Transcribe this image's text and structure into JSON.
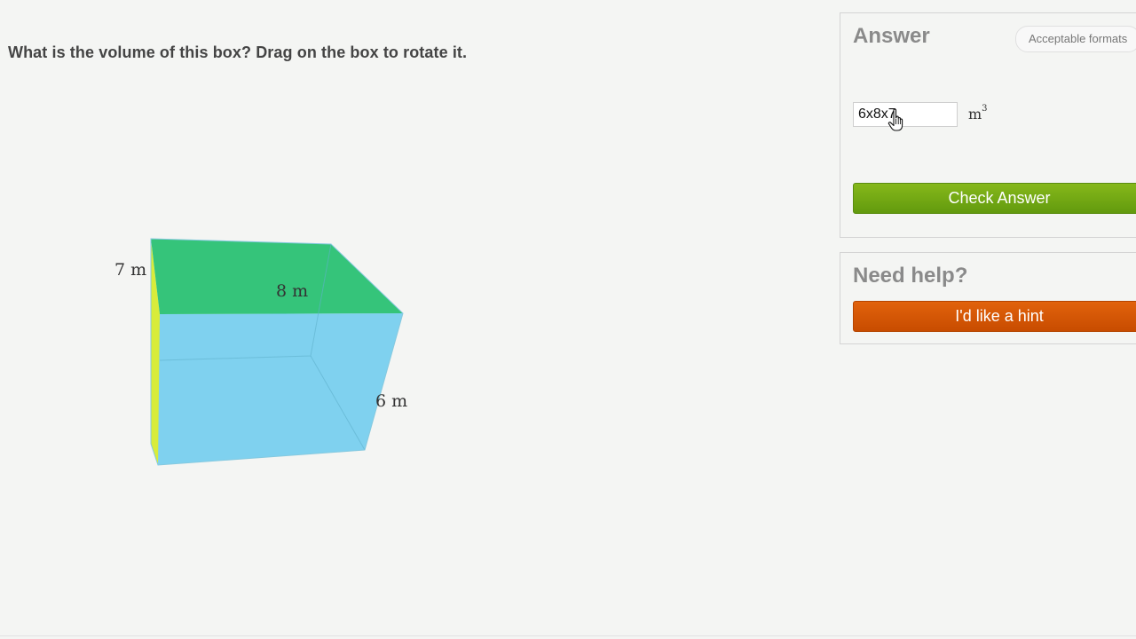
{
  "question": {
    "text": "What is the volume of this box? Drag on the box to rotate it."
  },
  "box": {
    "dimensions": {
      "height_label": "7 m",
      "length_label": "8 m",
      "width_label": "6 m"
    },
    "colors": {
      "top_face": "#35c47a",
      "front_face": "#78cfee",
      "side_face": "#d8ec3a"
    }
  },
  "answer_panel": {
    "title": "Answer",
    "formats_label": "Acceptable formats",
    "input_value": "6x8x7",
    "unit": "m",
    "unit_exponent": "3",
    "check_label": "Check Answer",
    "check_color": "#75ab14"
  },
  "help_panel": {
    "title": "Need help?",
    "hint_label": "I'd like a hint",
    "hint_color": "#d75707"
  },
  "cursor": {
    "icon": "hand-pointer-icon"
  }
}
